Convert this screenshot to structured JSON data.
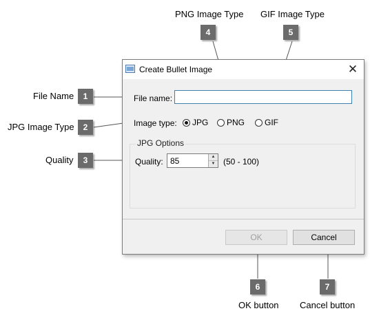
{
  "callouts": {
    "file_name": {
      "label": "File Name",
      "badge": "1"
    },
    "jpg_type": {
      "label": "JPG Image Type",
      "badge": "2"
    },
    "quality": {
      "label": "Quality",
      "badge": "3"
    },
    "png_type": {
      "label": "PNG Image Type",
      "badge": "4"
    },
    "gif_type": {
      "label": "GIF Image Type",
      "badge": "5"
    },
    "ok": {
      "label": "OK button",
      "badge": "6"
    },
    "cancel": {
      "label": "Cancel button",
      "badge": "7"
    }
  },
  "dialog": {
    "title": "Create Bullet Image",
    "close_glyph": "✕",
    "file_name_label": "File name:",
    "file_name_value": "",
    "image_type_label": "Image type:",
    "options": [
      {
        "label": "JPG",
        "checked": true
      },
      {
        "label": "PNG",
        "checked": false
      },
      {
        "label": "GIF",
        "checked": false
      }
    ],
    "jpg_options_title": "JPG Options",
    "quality_label": "Quality:",
    "quality_value": "85",
    "quality_range": "(50 - 100)",
    "ok_label": "OK",
    "ok_enabled": false,
    "cancel_label": "Cancel"
  },
  "colors": {
    "badge": "#6b6b6b",
    "dialog_bg": "#f0f0f0",
    "input_focus_border": "#3c7fb1"
  }
}
